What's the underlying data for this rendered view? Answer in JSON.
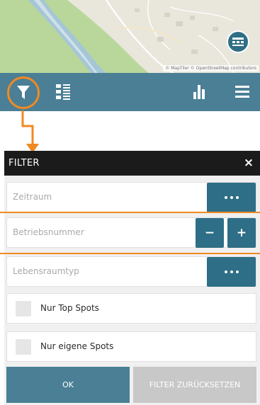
{
  "map": {
    "attribution": "© MapTiler © OpenStreetMap contributors",
    "layers_icon": "layers-icon",
    "colors": {
      "land": "#e9e6dc",
      "forest": "#b9d79a",
      "river": "#cfe0ea",
      "water_dark": "#a5c6d6"
    }
  },
  "toolbar": {
    "background": "#4a7f95",
    "icons": [
      "filter-icon",
      "list-view-icon",
      "bar-chart-icon",
      "hamburger-menu-icon"
    ]
  },
  "filter": {
    "title": "FILTER",
    "close_label": "×",
    "fields": {
      "zeitraum": {
        "placeholder": "Zeitraum"
      },
      "betriebsnummer": {
        "placeholder": "Betriebsnummer",
        "minus_label": "−",
        "plus_label": "+"
      },
      "lebensraumtyp": {
        "placeholder": "Lebensraumtyp"
      }
    },
    "checkboxes": {
      "top_spots": {
        "label": "Nur Top Spots",
        "checked": false
      },
      "eigene_spots": {
        "label": "Nur eigene Spots",
        "checked": false
      }
    },
    "ok_label": "OK",
    "reset_label": "FILTER ZURÜCKSETZEN"
  },
  "colors": {
    "accent": "#2e6e86",
    "highlight": "#f08a22",
    "header": "#1b1b1b",
    "disabled": "#c8c8c8"
  }
}
